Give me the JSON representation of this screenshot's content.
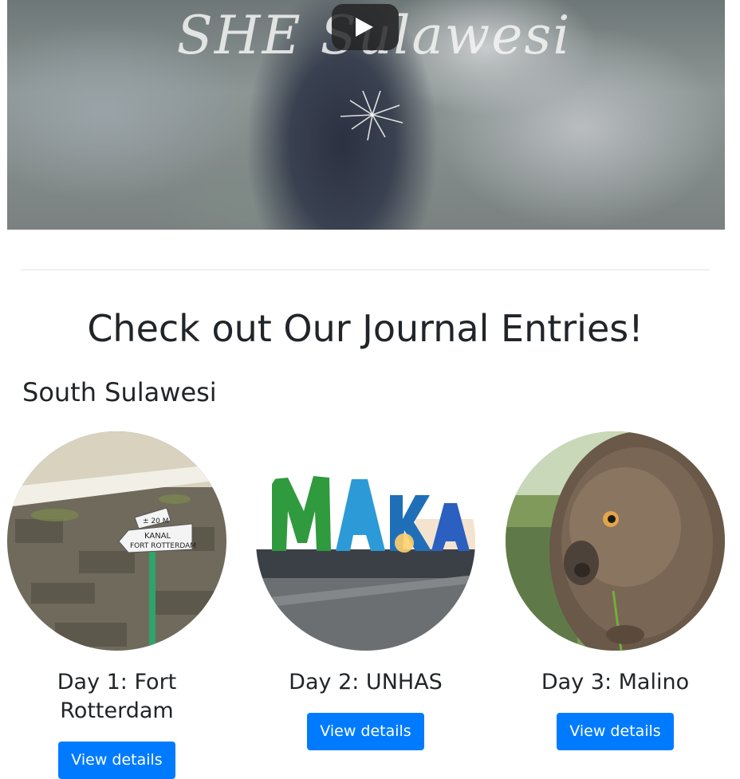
{
  "video": {
    "title_text": "SHE Sulawesi",
    "play_icon": "play-icon"
  },
  "section": {
    "heading": "Check out Our Journal Entries!",
    "region": "South Sulawesi"
  },
  "entries": [
    {
      "title": "Day 1: Fort Rotterdam",
      "button": "View details",
      "sign_top": "± 20 M",
      "sign_line1": "KANAL",
      "sign_line2": "FORT ROTTERDAM"
    },
    {
      "title": "Day 2: UNHAS",
      "button": "View details",
      "letters": "MAKAS"
    },
    {
      "title": "Day 3: Malino",
      "button": "View details"
    }
  ],
  "colors": {
    "primary": "#007bff",
    "text": "#212529",
    "divider": "#e3e3e3"
  }
}
